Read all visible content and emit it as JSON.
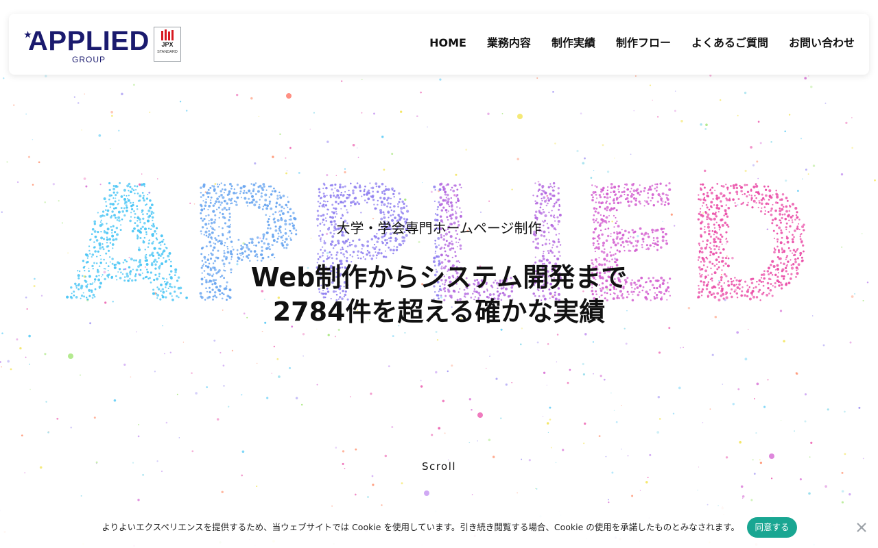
{
  "brand": {
    "name": "APPLIED",
    "group": "GROUP",
    "navy": "#1a1a6e"
  },
  "jpx_badge": {
    "code": "JPX",
    "market": "STANDARD",
    "accent": "#d71920"
  },
  "nav": [
    {
      "label": "HOME"
    },
    {
      "label": "業務内容"
    },
    {
      "label": "制作実績"
    },
    {
      "label": "制作フロー"
    },
    {
      "label": "よくあるご質問"
    },
    {
      "label": "お問い合わせ"
    }
  ],
  "hero": {
    "subtitle": "大学・学会専門ホームページ制作",
    "title_line1": "Web制作からシステム開発まで",
    "title_line2": "2784件を超える確かな実績",
    "particle_word": "APPLIED",
    "particle_colors": [
      "#4cc6f5",
      "#6aa6f0",
      "#8f7ff0",
      "#b56be0",
      "#d35fd0",
      "#ea4fa8"
    ]
  },
  "scroll": {
    "label": "Scroll"
  },
  "cookie": {
    "message": "よりよいエクスペリエンスを提供するため、当ウェブサイトでは Cookie を使用しています。引き続き閲覧する場合、Cookie の使用を承諾したものとみなされます。",
    "accept_label": "同意する",
    "accent": "#19a692"
  }
}
